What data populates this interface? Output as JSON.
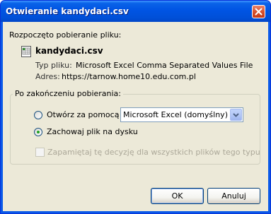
{
  "window": {
    "title": "Otwieranie kandydaci.csv"
  },
  "dialog": {
    "intro": "Rozpoczęto pobieranie pliku:",
    "file_name": "kandydaci.csv",
    "file_type_label": "Typ pliku:",
    "file_type_value": "Microsoft Excel Comma Separated Values File",
    "address_label": "Adres:",
    "address_value": "https://tarnow.home10.edu.com.pl",
    "group_label": "Po zakończeniu pobierania:",
    "open_with_label": "Otwórz za pomocą",
    "open_with_app": "Microsoft Excel (domyślny)",
    "save_label": "Zachowaj plik na dysku",
    "remember_label": "Zapamiętaj tę decyzję dla wszystkich plików tego typu",
    "selected_option": "save",
    "remember_checked": false,
    "remember_enabled": false
  },
  "buttons": {
    "ok": "OK",
    "cancel": "Anuluj"
  },
  "colors": {
    "titlebar": "#0054e3",
    "dialog_bg": "#ece9d8",
    "radio_dot": "#21a121",
    "close_button": "#d8532e"
  },
  "icons": {
    "close": "close-icon",
    "file": "csv-file-icon",
    "dropdown": "chevron-down-icon"
  }
}
